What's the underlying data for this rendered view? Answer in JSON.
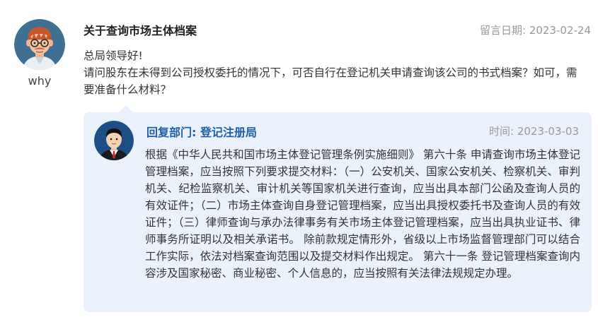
{
  "question": {
    "asker_name": "why",
    "title": "关于查询市场主体档案",
    "date_label": "留言日期:",
    "date_value": "2023-02-24",
    "greeting": "总局领导好!",
    "content": "请问股东在未得到公司授权委托的情况下，可否自行在登记机关申请查询该公司的书式档案？如可，需要准备什么材料？"
  },
  "reply": {
    "department": "回复部门: 登记注册局",
    "time_label": "时间:",
    "time_value": "2023-03-03",
    "content": "根据《中华人民共和国市场主体登记管理条例实施细则》 第六十条 申请查询市场主体登记管理档案，应当按照下列要求提交材料：（一）公安机关、国家公安机关、检察机关、审判机关、纪检监察机关、审计机关等国家机关进行查询，应当出具本部门公函及查询人员的有效证件；（二）市场主体查询自身登记管理档案，应当出具授权委托书及查询人员的有效证件；（三）律师查询与承办法律事务有关市场主体登记管理档案，应当出具执业证书、律师事务所证明以及相关承诺书。 除前款规定情形外，省级以上市场监督管理部门可以结合工作实际，依法对档案查询范围以及提交材料作出规定。 第六十一条 登记管理档案查询内容涉及国家秘密、商业秘密、个人信息的，应当按照有关法律法规规定办理。"
  },
  "colors": {
    "reply_background": "#eaf1fa",
    "department_blue": "#1f5fa8",
    "muted_gray": "#999999"
  },
  "icons": {
    "asker_avatar": "cartoon-man-avatar",
    "reply_avatar": "cartoon-official-avatar"
  }
}
